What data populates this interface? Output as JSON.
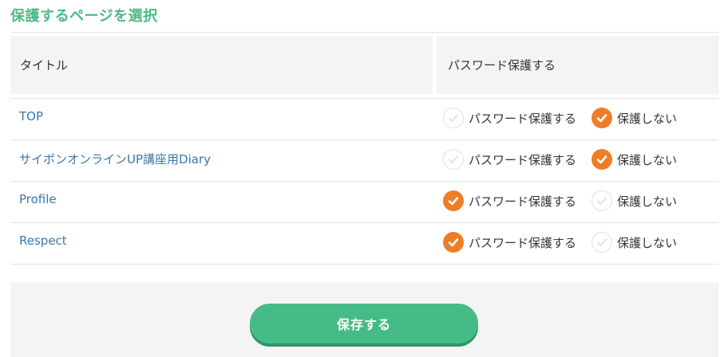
{
  "section": {
    "title": "保護するページを選択"
  },
  "table": {
    "headers": {
      "title": "タイトル",
      "password": "パスワード保護する"
    },
    "option_labels": {
      "protect": "パスワード保護する",
      "no_protect": "保護しない"
    },
    "rows": [
      {
        "title": "TOP",
        "protected": false
      },
      {
        "title": "サイポンオンラインUP講座用Diary",
        "protected": false
      },
      {
        "title": "Profile",
        "protected": true
      },
      {
        "title": "Respect",
        "protected": true
      }
    ]
  },
  "footer": {
    "save_label": "保存する"
  },
  "colors": {
    "accent_green": "#4cb987",
    "radio_selected": "#ee7d28",
    "link_blue": "#3b77a8"
  },
  "icons": {
    "radio_selected": "check-circle-icon",
    "radio_unselected": "check-circle-outline-icon"
  }
}
